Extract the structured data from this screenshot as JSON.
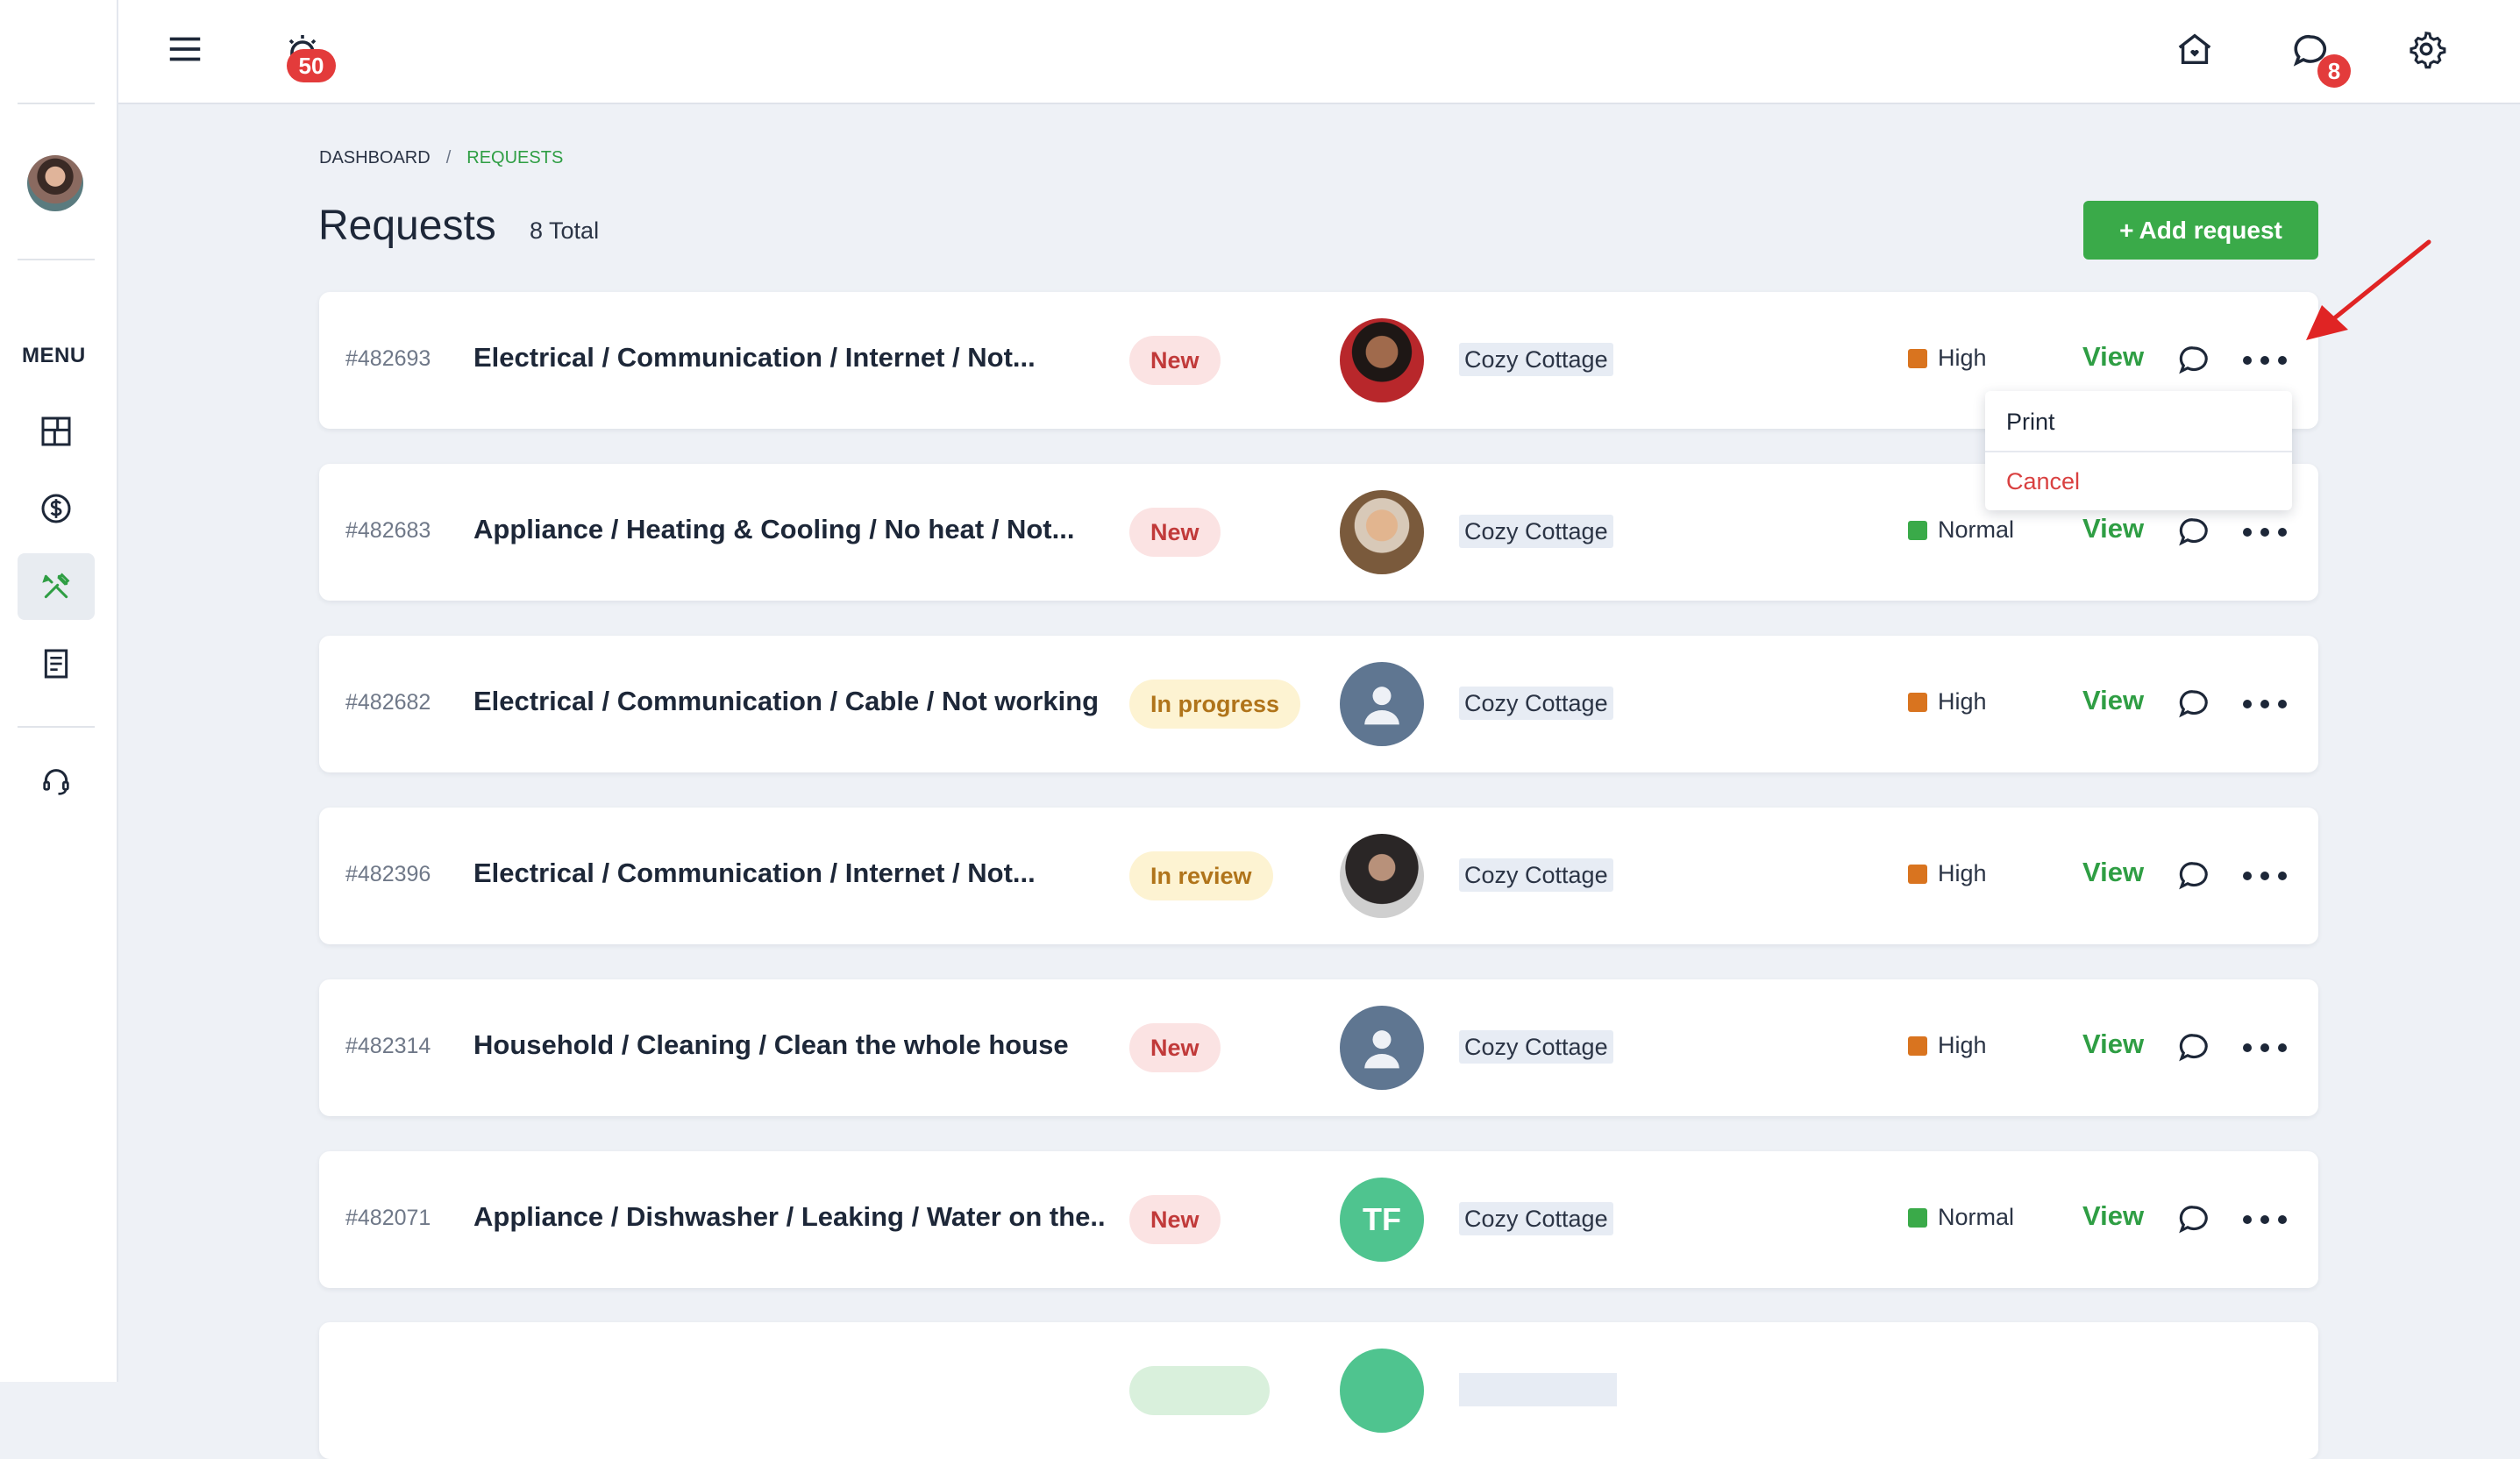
{
  "topbar": {
    "alarm_badge": "50",
    "chat_badge": "8"
  },
  "sidebar": {
    "menu_label": "MENU",
    "items": [
      {
        "icon": "dashboard-icon"
      },
      {
        "icon": "dollar-icon"
      },
      {
        "icon": "tools-icon",
        "active": true
      },
      {
        "icon": "document-icon"
      },
      {
        "icon": "headset-icon"
      }
    ]
  },
  "breadcrumb": {
    "parent": "DASHBOARD",
    "separator": "/",
    "current": "REQUESTS"
  },
  "page": {
    "title": "Requests",
    "total": "8 Total",
    "add_button": "Add request",
    "add_button_plus": "+"
  },
  "requests": [
    {
      "id": "#482693",
      "title": "Electrical / Communication / Internet / Not...",
      "status": "New",
      "avatar": "photo",
      "property": "Cozy Cottage",
      "priority": "High",
      "view": "View"
    },
    {
      "id": "#482683",
      "title": "Appliance / Heating & Cooling / No heat / Not...",
      "status": "New",
      "avatar": "photo",
      "property": "Cozy Cottage",
      "priority": "Normal",
      "view": "View"
    },
    {
      "id": "#482682",
      "title": "Electrical / Communication / Cable / Not working",
      "status": "In progress",
      "avatar": "placeholder",
      "property": "Cozy Cottage",
      "priority": "High",
      "view": "View"
    },
    {
      "id": "#482396",
      "title": "Electrical / Communication / Internet / Not...",
      "status": "In review",
      "avatar": "photo",
      "property": "Cozy Cottage",
      "priority": "High",
      "view": "View"
    },
    {
      "id": "#482314",
      "title": "Household / Cleaning / Clean the whole house",
      "status": "New",
      "avatar": "placeholder",
      "property": "Cozy Cottage",
      "priority": "High",
      "view": "View"
    },
    {
      "id": "#482071",
      "title": "Appliance / Dishwasher / Leaking / Water on the...",
      "status": "New",
      "avatar": "initials",
      "initials": "TF",
      "property": "Cozy Cottage",
      "priority": "Normal",
      "view": "View"
    }
  ],
  "dropdown": {
    "print": "Print",
    "cancel": "Cancel"
  },
  "colors": {
    "accent_green": "#3aaa49",
    "priority_high": "#d9741f",
    "priority_normal": "#3aaa49",
    "status_new_bg": "#fbe3e3",
    "status_progress_bg": "#fdf3d2",
    "badge_red": "#e33b3b",
    "arrow_red": "#e02424"
  }
}
